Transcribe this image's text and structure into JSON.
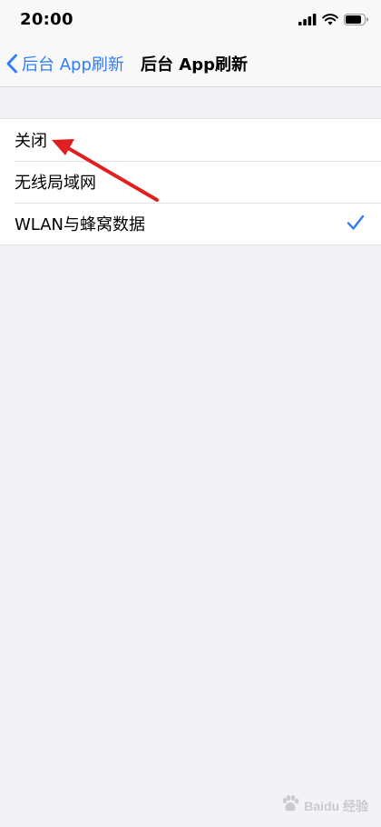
{
  "status_bar": {
    "time": "20:00",
    "icons": [
      "signal-icon",
      "wifi-icon",
      "battery-icon"
    ]
  },
  "nav": {
    "back_label": "后台 App刷新",
    "title": "后台 App刷新"
  },
  "options": [
    {
      "label": "关闭",
      "selected": false
    },
    {
      "label": "无线局域网",
      "selected": false
    },
    {
      "label": "WLAN与蜂窝数据",
      "selected": true
    }
  ],
  "annotation": {
    "type": "arrow",
    "color": "#e02020",
    "points_to": "关闭"
  },
  "watermark": {
    "text": "Baidu 经验",
    "icon": "baidu-paw-icon"
  },
  "colors": {
    "accent": "#2f7cf6",
    "background": "#f2f2f7",
    "arrow": "#e02020"
  }
}
